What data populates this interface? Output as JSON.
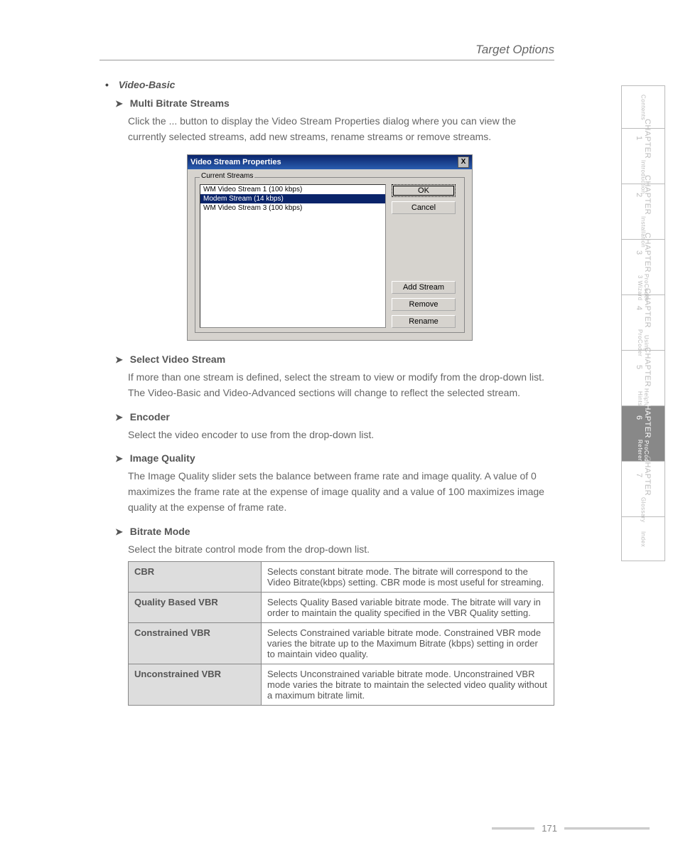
{
  "header": {
    "title": "Target Options"
  },
  "section": {
    "root_label": "Video-Basic",
    "items": [
      {
        "title": "Multi Bitrate Streams",
        "body": "Click the ... button to display the Video Stream Properties dialog where you can view the currently selected streams, add new streams, rename streams or remove streams."
      },
      {
        "title": "Select Video Stream",
        "body": "If more than one stream is defined, select the stream to view or modify from the drop-down list. The Video-Basic and Video-Advanced sections will change to reflect the selected stream."
      },
      {
        "title": "Encoder",
        "body": "Select the video encoder to use from the drop-down list."
      },
      {
        "title": "Image Quality",
        "body": "The Image Quality slider sets the balance between frame rate and image quality. A value of 0 maximizes the frame rate at the expense of image quality and a value of 100 maximizes image quality at the expense of frame rate."
      },
      {
        "title": "Bitrate Mode",
        "body": "Select the bitrate control mode from the drop-down list."
      }
    ]
  },
  "dialog": {
    "title": "Video Stream Properties",
    "group_label": "Current Streams",
    "list": [
      {
        "text": "WM Video Stream 1 (100 kbps)",
        "selected": false
      },
      {
        "text": "Modem Stream (14 kbps)",
        "selected": true
      },
      {
        "text": "WM Video Stream 3 (100 kbps)",
        "selected": false
      }
    ],
    "buttons": {
      "ok": "OK",
      "cancel": "Cancel",
      "add": "Add Stream",
      "remove": "Remove",
      "rename": "Rename"
    }
  },
  "table": {
    "rows": [
      {
        "name": "CBR",
        "desc": "Selects constant bitrate mode. The bitrate will correspond to the Video Bitrate(kbps) setting. CBR mode is most useful for streaming."
      },
      {
        "name": "Quality Based VBR",
        "desc": "Selects Quality Based variable bitrate mode. The bitrate will vary in order to maintain the quality specified in the VBR Quality setting."
      },
      {
        "name": "Constrained VBR",
        "desc": "Selects Constrained variable bitrate mode. Constrained VBR mode varies the bitrate up to the Maximum Bitrate (kbps) setting in order to maintain video quality."
      },
      {
        "name": "Unconstrained VBR",
        "desc": "Selects Unconstrained variable bitrate mode. Unconstrained VBR mode varies the bitrate to maintain the selected video quality without a maximum bitrate limit."
      }
    ]
  },
  "sidetabs": [
    {
      "big": "",
      "small": "Contents",
      "active": false
    },
    {
      "big": "CHAPTER 1",
      "small": "Introduction",
      "active": false
    },
    {
      "big": "CHAPTER 2",
      "small": "Installation",
      "active": false
    },
    {
      "big": "CHAPTER 3",
      "small": "ProCoder 3 Wizard",
      "active": false
    },
    {
      "big": "CHAPTER 4",
      "small": "Using ProCoder",
      "active": false
    },
    {
      "big": "CHAPTER 5",
      "small": "Helpful Hints",
      "active": false
    },
    {
      "big": "CHAPTER 6",
      "small": "ProCoder Reference",
      "active": true
    },
    {
      "big": "CHAPTER 7",
      "small": "Glossary",
      "active": false
    },
    {
      "big": "",
      "small": "Index",
      "active": false
    }
  ],
  "footer": {
    "page": "171"
  }
}
